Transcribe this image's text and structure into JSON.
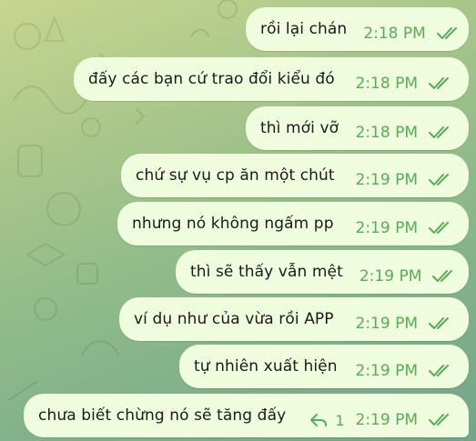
{
  "colors": {
    "bubble": "#effdde",
    "meta_green": "#5aaa5a",
    "text": "#1a1a1a"
  },
  "messages": [
    {
      "text": "rồi lại chán",
      "time": "2:18 PM",
      "status": "read-double-check-icon"
    },
    {
      "text": "đấy các bạn cứ trao đổi kiểu đó",
      "time": "2:18 PM",
      "status": "read-double-check-icon"
    },
    {
      "text": "thì mới vỡ",
      "time": "2:18 PM",
      "status": "read-double-check-icon"
    },
    {
      "text": "chứ sự vụ cp ăn một chút",
      "time": "2:19 PM",
      "status": "read-double-check-icon"
    },
    {
      "text": "nhưng nó không ngấm pp",
      "time": "2:19 PM",
      "status": "read-double-check-icon"
    },
    {
      "text": "thì sẽ thấy vẫn mệt",
      "time": "2:19 PM",
      "status": "read-double-check-icon"
    },
    {
      "text": "ví dụ như của vừa rồi APP",
      "time": "2:19 PM",
      "status": "read-double-check-icon"
    },
    {
      "text": "tự nhiên xuất hiện",
      "time": "2:19 PM",
      "status": "read-double-check-icon"
    },
    {
      "text": "chưa biết chừng nó sẽ tăng đấy",
      "time": "2:19 PM",
      "status": "read-double-check-icon",
      "reply_count": "1",
      "reply_icon": "reply-arrow-icon"
    }
  ]
}
